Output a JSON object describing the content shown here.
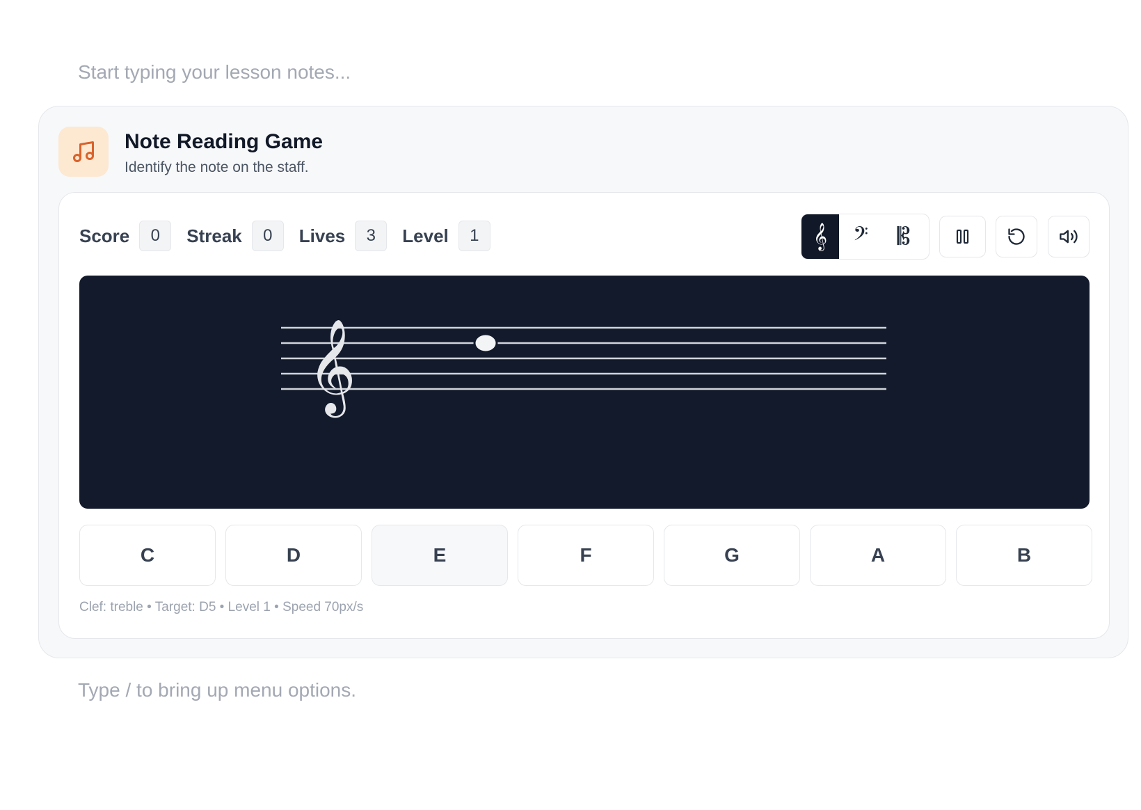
{
  "editor": {
    "top_placeholder": "Start typing your lesson notes...",
    "bottom_placeholder": "Type / to bring up menu options."
  },
  "card": {
    "title": "Note Reading Game",
    "subtitle": "Identify the note on the staff.",
    "icon": "music-note-icon",
    "accent": "#d9622b"
  },
  "stats": [
    {
      "label": "Score",
      "value": "0"
    },
    {
      "label": "Streak",
      "value": "0"
    },
    {
      "label": "Lives",
      "value": "3"
    },
    {
      "label": "Level",
      "value": "1"
    }
  ],
  "toolbar": {
    "clefs": [
      {
        "icon": "treble-clef-icon",
        "glyph": "𝄞",
        "active": true
      },
      {
        "icon": "bass-clef-icon",
        "glyph": "𝄢",
        "active": false
      },
      {
        "icon": "alto-clef-icon",
        "glyph": "𝄡",
        "active": false
      }
    ],
    "pause_icon": "pause-icon",
    "restart_icon": "restart-icon",
    "sound_icon": "volume-icon"
  },
  "stage": {
    "background": "#131a2b",
    "clef_glyph": "𝄞",
    "current_note": "D5"
  },
  "answers": [
    "C",
    "D",
    "E",
    "F",
    "G",
    "A",
    "B"
  ],
  "status": {
    "text": "Clef: treble • Target: D5 • Level 1 • Speed 70px/s"
  }
}
